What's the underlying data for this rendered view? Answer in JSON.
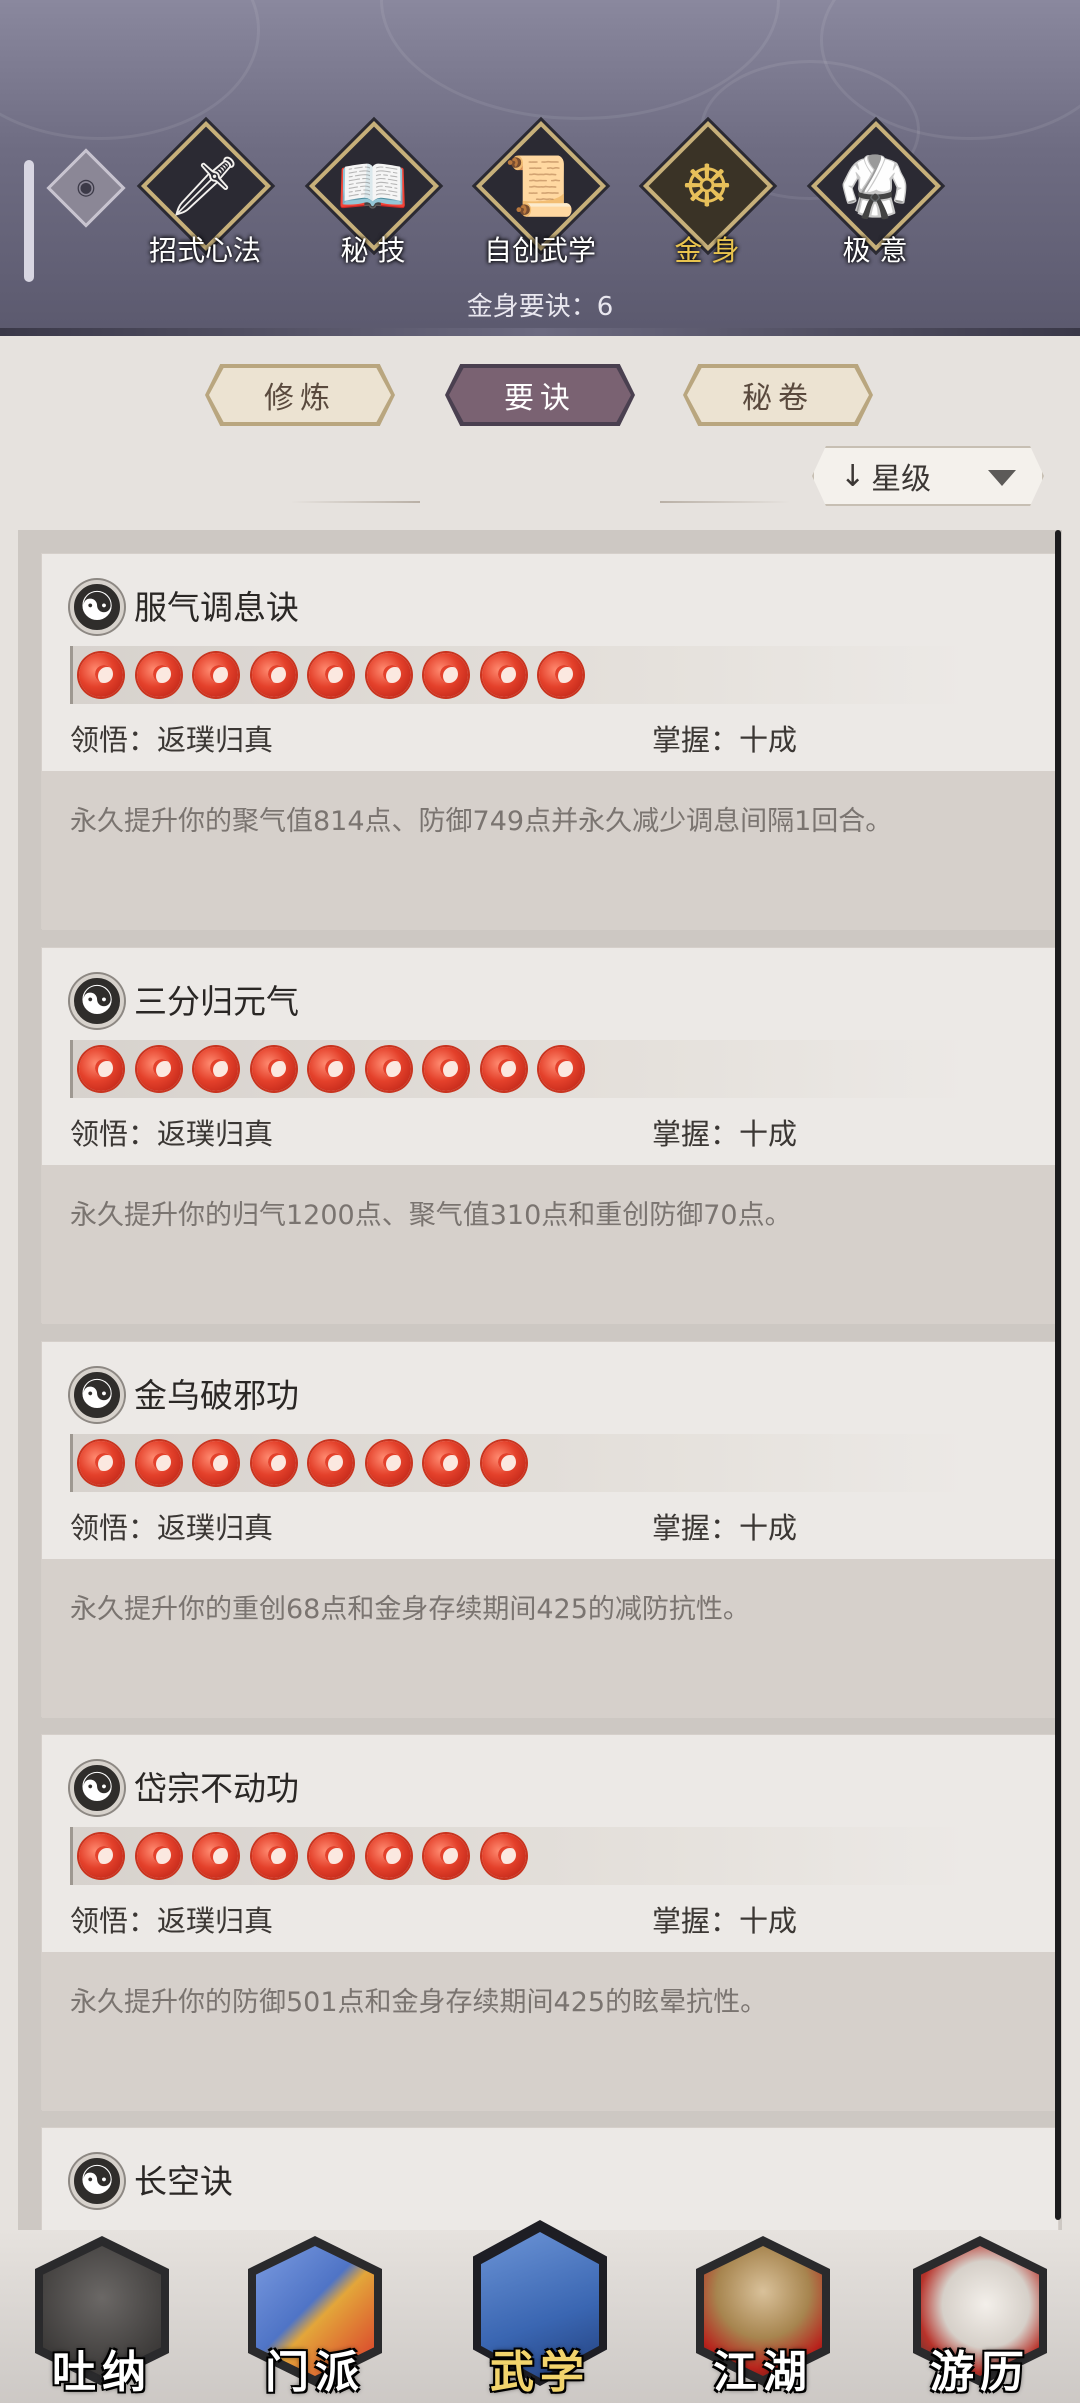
{
  "header": {
    "top_tabs": [
      {
        "label": "招式心法",
        "icon": "sword-icon"
      },
      {
        "label": "秘 技",
        "icon": "book-icon"
      },
      {
        "label": "自创武学",
        "icon": "scroll-icon"
      },
      {
        "label": "金 身",
        "icon": "meditation-icon"
      },
      {
        "label": "极 意",
        "icon": "martial-stance-icon"
      }
    ],
    "active_tab": "金 身",
    "count_text": "金身要诀：6"
  },
  "sub_tabs": [
    {
      "label": "修炼"
    },
    {
      "label": "要诀"
    },
    {
      "label": "秘卷"
    }
  ],
  "active_sub_tab": "要诀",
  "sort": {
    "label": "星级",
    "arrow": "↓"
  },
  "cards": [
    {
      "name": "服气调息诀",
      "stars": 9,
      "ling_label": "领悟：返璞归真",
      "zhang_label": "掌握：十成",
      "desc": "永久提升你的聚气值814点、防御749点并永久减少调息间隔1回合。"
    },
    {
      "name": "三分归元气",
      "stars": 9,
      "ling_label": "领悟：返璞归真",
      "zhang_label": "掌握：十成",
      "desc": "永久提升你的归气1200点、聚气值310点和重创防御70点。"
    },
    {
      "name": "金乌破邪功",
      "stars": 8,
      "ling_label": "领悟：返璞归真",
      "zhang_label": "掌握：十成",
      "desc": "永久提升你的重创68点和金身存续期间425的减防抗性。"
    },
    {
      "name": "岱宗不动功",
      "stars": 8,
      "ling_label": "领悟：返璞归真",
      "zhang_label": "掌握：十成",
      "desc": "永久提升你的防御501点和金身存续期间425的眩晕抗性。"
    },
    {
      "name": "长空诀"
    }
  ],
  "bottom_nav": [
    {
      "label": "吐纳",
      "icon": "meditating-figure-icon",
      "color": "#3a3836"
    },
    {
      "label": "门派",
      "icon": "sect-flags-icon",
      "color": "#5c7fc9"
    },
    {
      "label": "武学",
      "icon": "martial-books-icon",
      "color": "#3c6db8"
    },
    {
      "label": "江湖",
      "icon": "straw-hat-icon",
      "color": "#a37f4d"
    },
    {
      "label": "游历",
      "icon": "white-horse-icon",
      "color": "#d9d4cf"
    }
  ],
  "active_nav": "武学"
}
